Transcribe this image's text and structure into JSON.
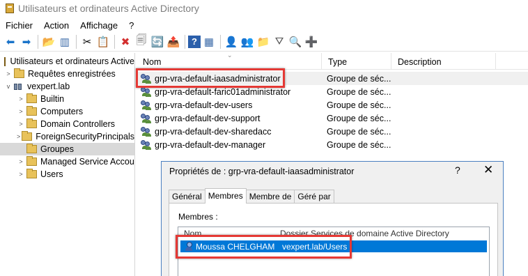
{
  "window": {
    "title": "Utilisateurs et ordinateurs Active Directory"
  },
  "menu": [
    "Fichier",
    "Action",
    "Affichage",
    "?"
  ],
  "toolbar": {
    "icons": [
      "back-arrow-icon",
      "forward-arrow-icon",
      "up-folder-icon",
      "show-hide-tree-icon",
      "cut-icon",
      "copy-icon",
      "delete-icon",
      "properties-icon",
      "refresh-icon",
      "export-list-icon",
      "help-icon",
      "console-view-icon",
      "new-user-icon",
      "new-group-icon",
      "new-ou-icon",
      "filter-icon",
      "find-icon",
      "add-to-group-icon"
    ],
    "glyphs": [
      "⬅",
      "➡",
      "📂",
      "▥",
      "✂",
      "📋",
      "✖",
      "🗐",
      "🔄",
      "📤",
      "?",
      "▦",
      "👤",
      "👥",
      "📁",
      "⛛",
      "🔍",
      "➕"
    ]
  },
  "tree": {
    "root": "Utilisateurs et ordinateurs Active",
    "saved_queries": "Requêtes enregistrées",
    "domain": "vexpert.lab",
    "folders": [
      "Builtin",
      "Computers",
      "Domain Controllers",
      "ForeignSecurityPrincipals",
      "Groupes",
      "Managed Service Accou",
      "Users"
    ],
    "selected": "Groupes"
  },
  "list": {
    "columns": {
      "name": "Nom",
      "type": "Type",
      "description": "Description"
    },
    "rows": [
      {
        "name": "grp-vra-default-iaasadministrator",
        "type": "Groupe de séc..."
      },
      {
        "name": "grp-vra-default-faric01administrator",
        "type": "Groupe de séc..."
      },
      {
        "name": "grp-vra-default-dev-users",
        "type": "Groupe de séc..."
      },
      {
        "name": "grp-vra-default-dev-support",
        "type": "Groupe de séc..."
      },
      {
        "name": "grp-vra-default-dev-sharedacc",
        "type": "Groupe de séc..."
      },
      {
        "name": "grp-vra-default-dev-manager",
        "type": "Groupe de séc..."
      }
    ]
  },
  "dialog": {
    "title": "Propriétés de : grp-vra-default-iaasadministrator",
    "help": "?",
    "close": "✕",
    "tabs": [
      "Général",
      "Membres",
      "Membre de",
      "Géré par"
    ],
    "active_tab": "Membres",
    "members_label": "Membres :",
    "columns": {
      "name": "Nom",
      "folder": "Dossier Services de domaine Active Directory"
    },
    "member": {
      "name": "Moussa CHELGHAM",
      "folder": "vexpert.lab/Users"
    }
  },
  "colors": {
    "selection": "#0078d7",
    "highlight_box": "#e53935",
    "dialog_border": "#4a7fc0"
  }
}
